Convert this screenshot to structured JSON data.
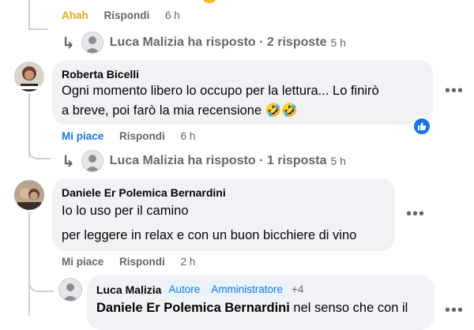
{
  "top": {
    "reaction_label": "Ahah",
    "reply_label": "Rispondi",
    "time": "6 h",
    "replies_summary": "Luca Malizia ha risposto · 2 risposte",
    "replies_time": "5 h"
  },
  "comment1": {
    "author": "Roberta Bicelli",
    "line1": "Ogni momento libero lo occupo per la lettura... Lo finirò",
    "line2": "a breve, poi farò la mia recensione 🤣🤣",
    "like_label": "Mi piace",
    "reply_label": "Rispondi",
    "time": "6 h",
    "replies_summary": "Luca Malizia ha risposto · 1 risposta",
    "replies_time": "5 h",
    "more_glyph": "•••"
  },
  "comment2": {
    "author": "Daniele Er Polemica Bernardini",
    "line1": "Io lo uso per il camino",
    "line2": "per leggere in relax e con un buon bicchiere di vino",
    "like_label": "Mi piace",
    "reply_label": "Rispondi",
    "time": "2 h",
    "more_glyph": "•••"
  },
  "reply": {
    "author": "Luca Malizia",
    "badge1": "Autore",
    "badge2": "Amministratore",
    "extra_badges": "+4",
    "mention": "Daniele Er Polemica Bernardini",
    "text": " nel senso che con il",
    "more_glyph": "•••"
  },
  "icons": {
    "reply_arrow": "↳",
    "like": "like-icon"
  },
  "colors": {
    "ahah": "#e5a823",
    "like_blue": "#1b74e4",
    "bubble": "#f0f2f5",
    "secondary_text": "#65676b",
    "badge_bg": "#e7f3ff"
  }
}
